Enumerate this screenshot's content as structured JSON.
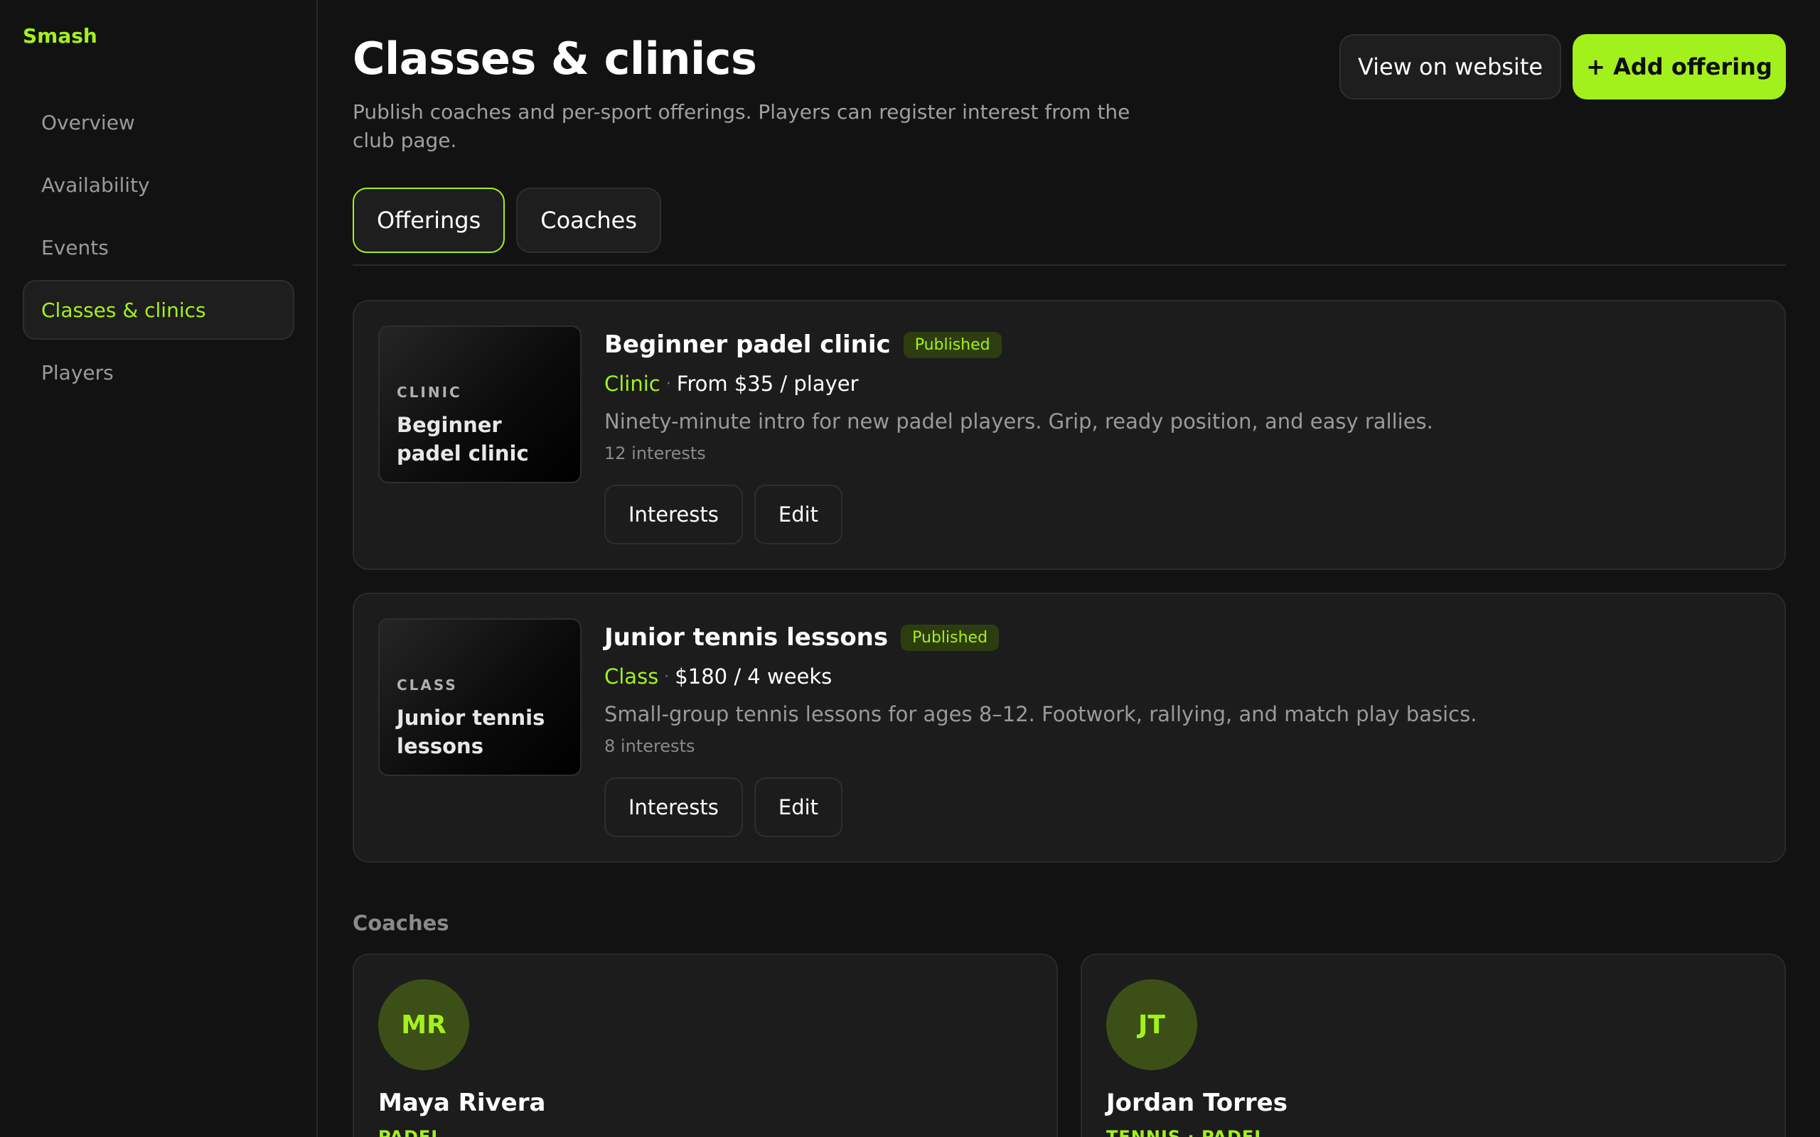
{
  "app": {
    "name": "Smash"
  },
  "sidebar": {
    "items": [
      {
        "label": "Overview"
      },
      {
        "label": "Availability"
      },
      {
        "label": "Events"
      },
      {
        "label": "Classes & clinics",
        "active": true
      },
      {
        "label": "Players"
      }
    ]
  },
  "header": {
    "title": "Classes & clinics",
    "subtitle": "Publish coaches and per-sport offerings. Players can register interest from the club page.",
    "view_label": "View on website",
    "add_label": "+ Add offering"
  },
  "tabs": [
    {
      "label": "Offerings",
      "active": true
    },
    {
      "label": "Coaches"
    }
  ],
  "offerings": [
    {
      "thumb_kind": "CLINIC",
      "thumb_title": "Beginner padel clinic",
      "title": "Beginner padel clinic",
      "status": "Published",
      "kind": "Clinic",
      "separator": "·",
      "price": "From $35 / player",
      "description": "Ninety-minute intro for new padel players. Grip, ready position, and easy rallies.",
      "interests": "12 interests",
      "interests_label": "Interests",
      "edit_label": "Edit"
    },
    {
      "thumb_kind": "CLASS",
      "thumb_title": "Junior tennis lessons",
      "title": "Junior tennis lessons",
      "status": "Published",
      "kind": "Class",
      "separator": "·",
      "price": "$180 / 4 weeks",
      "description": "Small-group tennis lessons for ages 8–12. Footwork, rallying, and match play basics.",
      "interests": "8 interests",
      "interests_label": "Interests",
      "edit_label": "Edit"
    }
  ],
  "coaches_section": {
    "label": "Coaches",
    "coaches": [
      {
        "initials": "MR",
        "name": "Maya Rivera",
        "sports": "PADEL"
      },
      {
        "initials": "JT",
        "name": "Jordan Torres",
        "sports": "TENNIS · PADEL"
      }
    ]
  },
  "colors": {
    "accent": "#a3f11c",
    "background": "#121212",
    "card": "#1c1c1c",
    "border": "#2a2a2a"
  }
}
